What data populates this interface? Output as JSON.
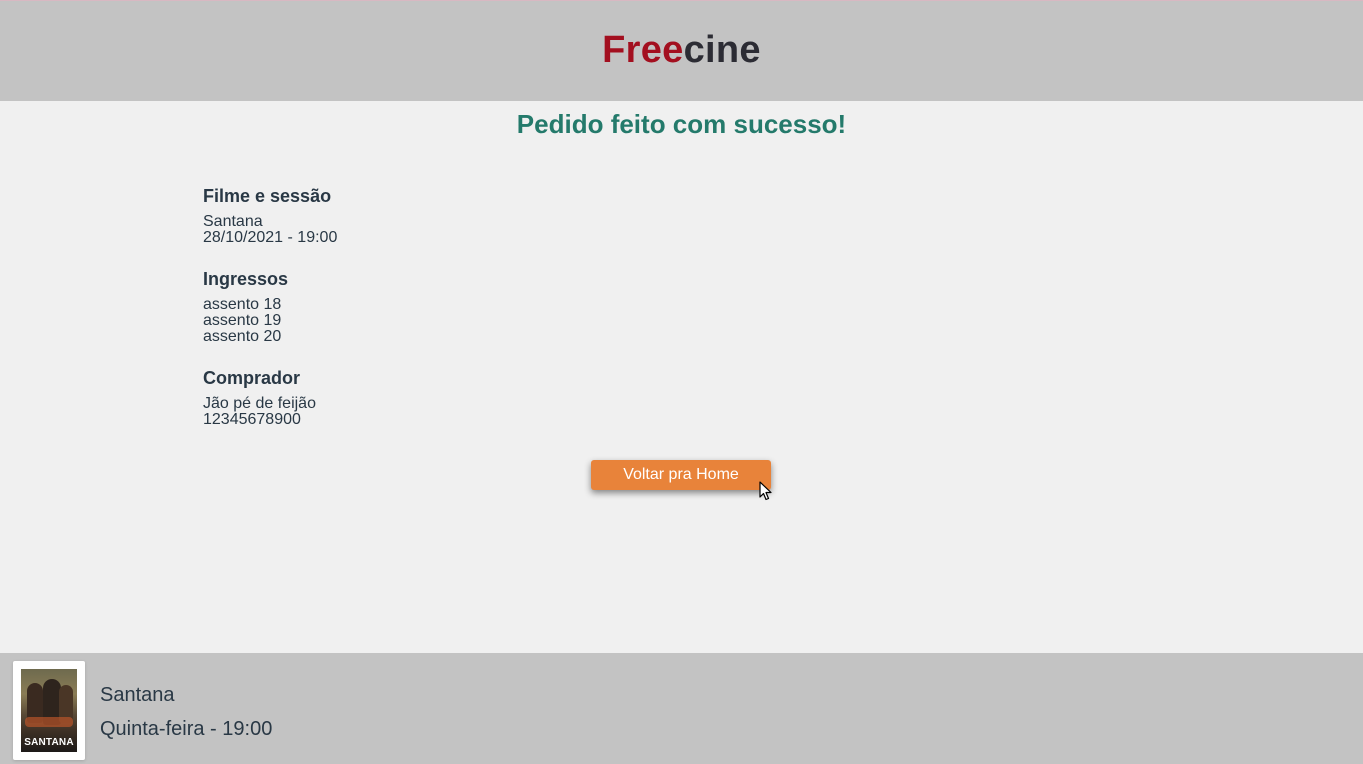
{
  "header": {
    "brand_part1": "Free",
    "brand_part2": "cine",
    "brand_color": "#a30f1f"
  },
  "success_message": "Pedido feito com sucesso!",
  "movie_section": {
    "heading": "Filme e sessão",
    "title": "Santana",
    "datetime": "28/10/2021 - 19:00"
  },
  "tickets_section": {
    "heading": "Ingressos",
    "seats": [
      "assento 18",
      "assento 19",
      "assento 20"
    ]
  },
  "buyer_section": {
    "heading": "Comprador",
    "name": "Jão pé de feijão",
    "cpf": "12345678900"
  },
  "home_button": {
    "label": "Voltar pra Home",
    "color": "#e8833a"
  },
  "footer": {
    "poster_title": "SANTANA",
    "movie_title": "Santana",
    "session": "Quinta-feira - 19:00"
  }
}
